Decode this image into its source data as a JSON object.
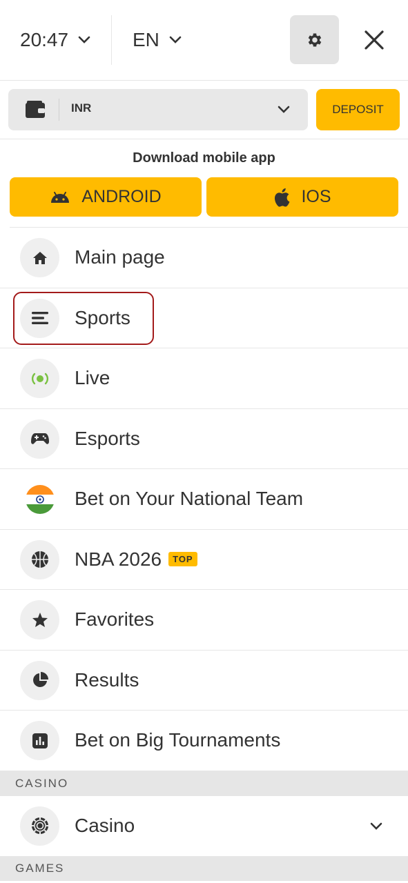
{
  "header": {
    "time": "20:47",
    "language": "EN"
  },
  "wallet": {
    "currency": "INR",
    "deposit_label": "DEPOSIT"
  },
  "download": {
    "title": "Download mobile app",
    "android_label": "ANDROID",
    "ios_label": "IOS"
  },
  "menu": {
    "items": [
      {
        "label": "Main page",
        "icon": "home-icon"
      },
      {
        "label": "Sports",
        "icon": "menu-lines-icon"
      },
      {
        "label": "Live",
        "icon": "live-signal-icon"
      },
      {
        "label": "Esports",
        "icon": "gamepad-icon"
      },
      {
        "label": "Bet on Your National Team",
        "icon": "india-flag-icon"
      },
      {
        "label": "NBA 2026",
        "icon": "basketball-icon",
        "badge": "TOP"
      },
      {
        "label": "Favorites",
        "icon": "star-icon"
      },
      {
        "label": "Results",
        "icon": "pie-chart-icon"
      },
      {
        "label": "Bet on Big Tournaments",
        "icon": "bar-chart-icon"
      }
    ]
  },
  "sections": {
    "casino_header": "CASINO",
    "casino_label": "Casino",
    "games_header": "GAMES"
  },
  "colors": {
    "accent": "#ffbb00",
    "highlight": "#a31a1a",
    "live_green": "#7ac142"
  }
}
